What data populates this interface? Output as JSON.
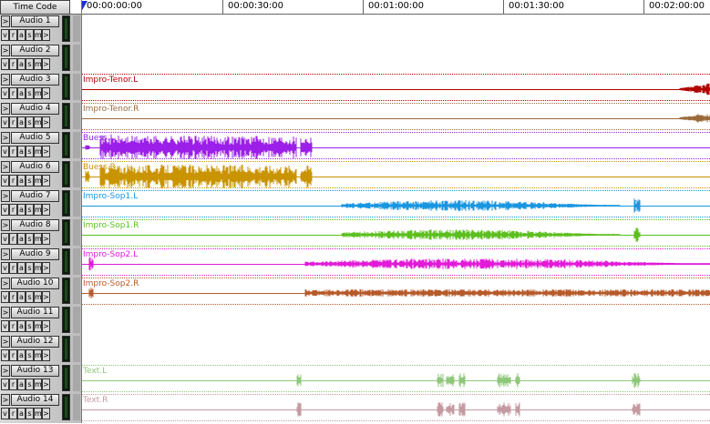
{
  "header": {
    "time_code_label": "Time Code"
  },
  "ruler": {
    "marks": [
      "00:00:00:00",
      "00:00:30:00",
      "00:01:00:00",
      "00:01:30:00",
      "00:02:00:00"
    ]
  },
  "track_buttons": [
    "v",
    "r",
    "a",
    "s",
    "m",
    ">"
  ],
  "tracks": [
    {
      "name": "Audio 1",
      "clip": "",
      "color": ""
    },
    {
      "name": "Audio 2",
      "clip": "",
      "color": ""
    },
    {
      "name": "Audio 3",
      "clip": "Impro-Tenor.L",
      "color": "#b00000"
    },
    {
      "name": "Audio 4",
      "clip": "Impro-Tenor.R",
      "color": "#9a6a3a"
    },
    {
      "name": "Audio 5",
      "clip": "Buess.L",
      "color": "#9b1fe8"
    },
    {
      "name": "Audio 6",
      "clip": "Buess.R",
      "color": "#c99400"
    },
    {
      "name": "Audio 7",
      "clip": "Impro-Sop1.L",
      "color": "#1996e0"
    },
    {
      "name": "Audio 8",
      "clip": "Impro-Sop1.R",
      "color": "#5cbf1f"
    },
    {
      "name": "Audio 9",
      "clip": "Impro-Sop2.L",
      "color": "#e21ad8"
    },
    {
      "name": "Audio 10",
      "clip": "Impro-Sop2.R",
      "color": "#b65a2a"
    },
    {
      "name": "Audio 11",
      "clip": "",
      "color": ""
    },
    {
      "name": "Audio 12",
      "clip": "",
      "color": ""
    },
    {
      "name": "Audio 13",
      "clip": "Text.L",
      "color": "#8fc77a"
    },
    {
      "name": "Audio 14",
      "clip": "Text.R",
      "color": "#c49aa0"
    }
  ]
}
